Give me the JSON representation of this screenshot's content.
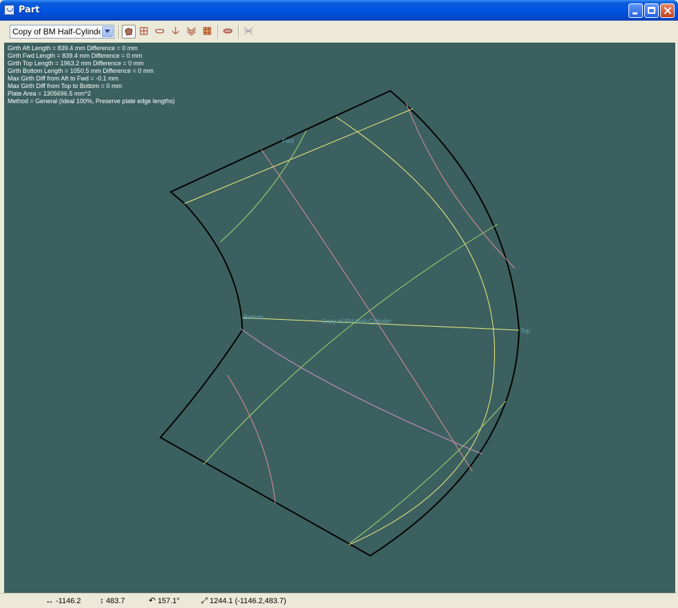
{
  "window": {
    "title": "Part"
  },
  "toolbar": {
    "part_select_value": "Copy of BM Half-Cylinder",
    "tools": [
      "plate-icon",
      "grid-icon",
      "section-icon",
      "anchor-icon",
      "frames-icon",
      "mesh-icon",
      "rotate-icon",
      "reset-icon"
    ]
  },
  "info_lines": [
    "Girth Aft Length = 839.4 mm Difference = 0 mm",
    "Girth Fwd Length = 839.4 mm Difference = 0 mm",
    "Girth Top Length = 1963.2 mm Difference = 0 mm",
    "Girth Bottom Length = 1050.5 mm Difference = 0 mm",
    "Max Girth Diff from Aft to Fwd = -0.1 mm",
    "Max Girth Diff from Top to Bottom = 0 mm",
    "Plate Area = 1305696.5 mm^2",
    "Method = General (Ideal 100%, Preserve plate edge lengths)"
  ],
  "labels": {
    "fwd": "Fwd",
    "bottom": "Bottom",
    "top": "Top",
    "center": "Copy of BM Half-Cylinder"
  },
  "colors": {
    "background": "#3C6060",
    "outline": "#000000",
    "yellow": "#F0F080",
    "green": "#A8D870",
    "pink": "#E090A0",
    "violet": "#D898C8"
  },
  "status": {
    "x": "-1146.2",
    "y": "483.7",
    "angle": "157.1°",
    "length": "1244.1",
    "coords": "(-1146.2,483.7)"
  }
}
